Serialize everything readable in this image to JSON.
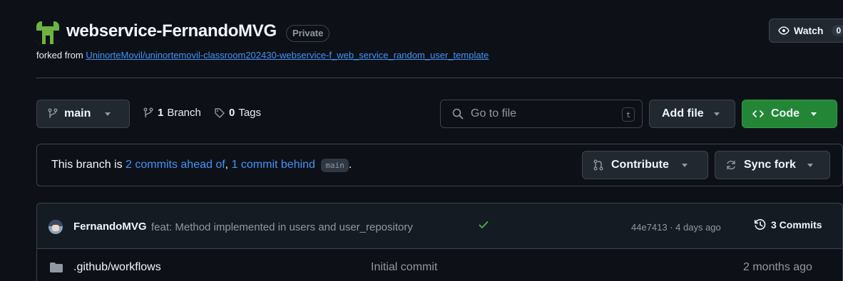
{
  "repo": {
    "name": "webservice-FernandoMVG",
    "visibility": "Private",
    "forked_prefix": "forked from ",
    "forked_source": "UninorteMovil/uninortemovil-classroom202430-webservice-f_web_service_random_user_template",
    "watch_label": "Watch",
    "watch_count": "0"
  },
  "toolbar": {
    "branch": "main",
    "branch_count": "1",
    "branch_word": "Branch",
    "tag_count": "0",
    "tag_word": "Tags",
    "search_placeholder": "Go to file",
    "search_shortcut": "t",
    "add_file_label": "Add file",
    "code_label": "Code"
  },
  "fork_status": {
    "prefix": "This branch is ",
    "ahead": "2 commits ahead of",
    "sep": ", ",
    "behind": "1 commit behind",
    "base_branch": "main",
    "suffix": ".",
    "contribute_label": "Contribute",
    "sync_label": "Sync fork"
  },
  "latest_commit": {
    "author": "FernandoMVG",
    "message": "feat: Method implemented in users and user_repository",
    "meta": "44e7413 · 4 days ago",
    "commits_label": "3 Commits"
  },
  "files": [
    {
      "name": ".github/workflows",
      "commit": "Initial commit",
      "date": "2 months ago",
      "icon": "folder-icon"
    }
  ],
  "colors": {
    "background": "#0d1117",
    "link": "#4493f8",
    "code_button": "#238636",
    "success_check": "#3fb950",
    "logo": "#6cb342"
  }
}
